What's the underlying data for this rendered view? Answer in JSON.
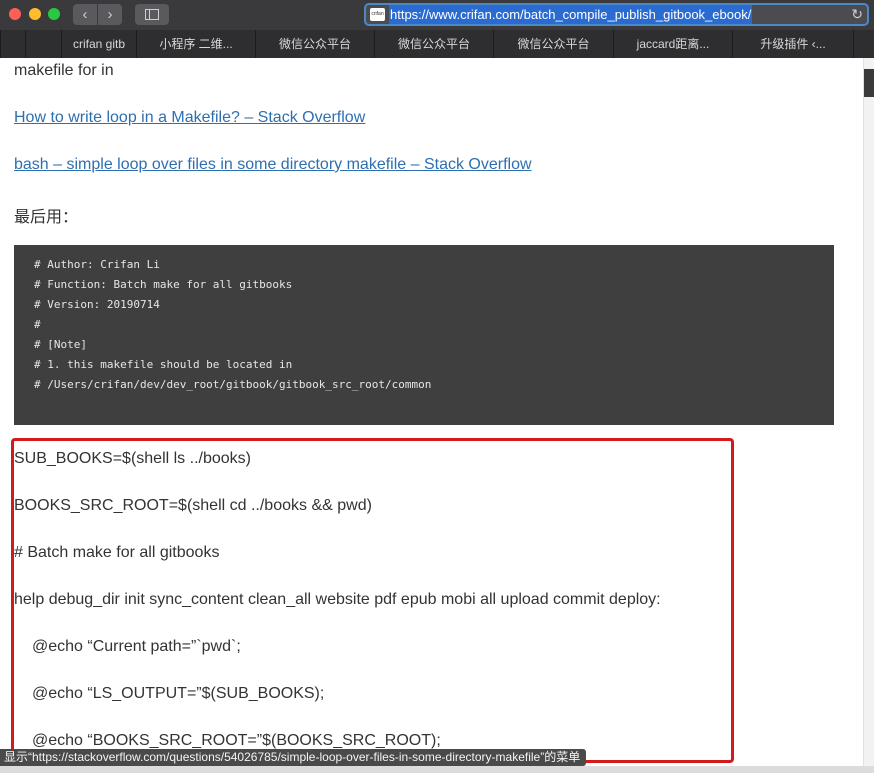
{
  "toolbar": {
    "url": "https://www.crifan.com/batch_compile_publish_gitbook_ebook/",
    "favicon_text": "crifan"
  },
  "bookmarks": [
    "crifan gitb",
    "小程序 二维...",
    "微信公众平台",
    "微信公众平台",
    "微信公众平台",
    "jaccard距离...",
    "升级插件 ‹..."
  ],
  "page": {
    "line_makefile": "makefile for in",
    "link1": "How to write loop in a Makefile? – Stack Overflow",
    "link2": "bash – simple loop over files in some directory makefile – Stack Overflow",
    "final_used": "最后用：",
    "code_lines": [
      "# Author: Crifan Li",
      "# Function: Batch make for all gitbooks",
      "# Version: 20190714",
      "#",
      "# [Note]",
      "# 1. this makefile should be located in",
      "# /Users/crifan/dev/dev_root/gitbook/gitbook_src_root/common"
    ],
    "body_lines": [
      "SUB_BOOKS=$(shell ls ../books)",
      "BOOKS_SRC_ROOT=$(shell cd ../books && pwd)",
      "# Batch make for all gitbooks",
      "help debug_dir init sync_content clean_all website pdf epub mobi all upload commit deploy:",
      "@echo “Current path=”`pwd`;",
      "@echo “LS_OUTPUT=”$(SUB_BOOKS);",
      "@echo “BOOKS_SRC_ROOT=”$(BOOKS_SRC_ROOT);"
    ]
  },
  "status_bar": {
    "text": "显示“https://stackoverflow.com/questions/54026785/simple-loop-over-files-in-some-directory-makefile”的菜单"
  },
  "colors": {
    "highlight_border": "#d4191b",
    "link": "#2e6fb0",
    "code_bg": "#3f3f3f"
  }
}
